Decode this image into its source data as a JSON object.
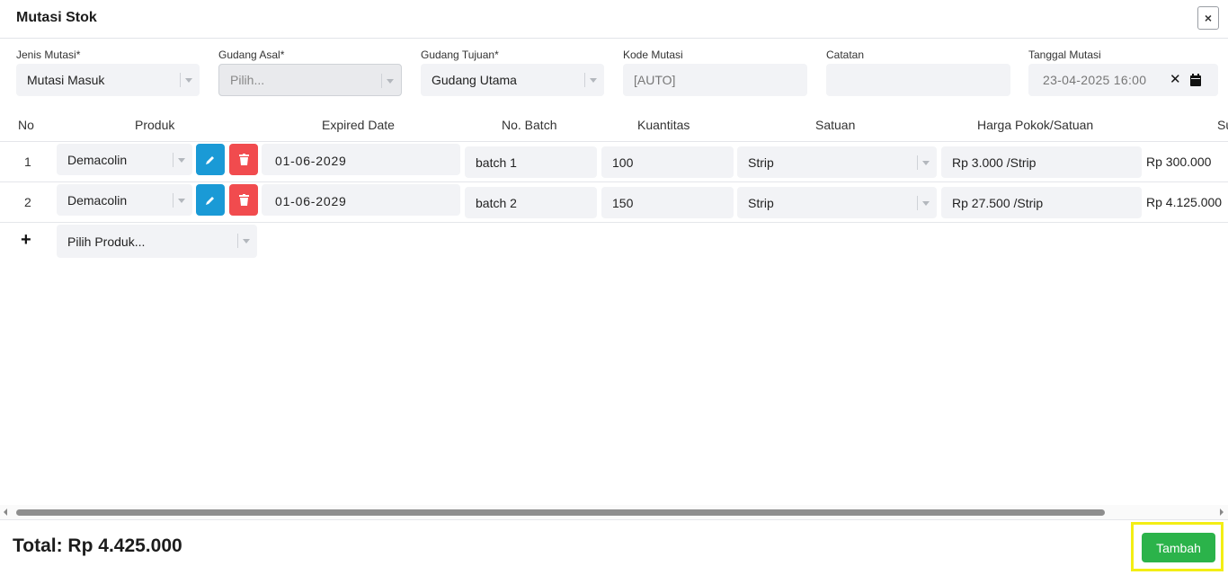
{
  "modal": {
    "title": "Mutasi Stok",
    "close_label": "×"
  },
  "form": {
    "jenis_mutasi": {
      "label": "Jenis Mutasi*",
      "value": "Mutasi Masuk"
    },
    "gudang_asal": {
      "label": "Gudang Asal*",
      "placeholder": "Pilih..."
    },
    "gudang_tujuan": {
      "label": "Gudang Tujuan*",
      "value": "Gudang Utama"
    },
    "kode_mutasi": {
      "label": "Kode Mutasi",
      "value": "[AUTO]"
    },
    "catatan": {
      "label": "Catatan",
      "value": ""
    },
    "tanggal_mutasi": {
      "label": "Tanggal Mutasi",
      "value": "23-04-2025 16:00"
    }
  },
  "table": {
    "headers": [
      "No",
      "Produk",
      "Expired Date",
      "No. Batch",
      "Kuantitas",
      "Satuan",
      "Harga Pokok/Satuan",
      "Su"
    ],
    "rows": [
      {
        "no": "1",
        "produk": "Demacolin",
        "expired": "01-06-2029",
        "batch": "batch 1",
        "qty": "100",
        "satuan": "Strip",
        "harga": "Rp 3.000 /Strip",
        "subtotal": "Rp 300.000"
      },
      {
        "no": "2",
        "produk": "Demacolin",
        "expired": "01-06-2029",
        "batch": "batch 2",
        "qty": "150",
        "satuan": "Strip",
        "harga": "Rp 27.500 /Strip",
        "subtotal": "Rp 4.125.000"
      }
    ],
    "add_row": {
      "icon": "+",
      "placeholder": "Pilih Produk..."
    }
  },
  "footer": {
    "total": "Total: Rp 4.425.000",
    "add_button": "Tambah",
    "highlight_color": "#f3ee14"
  },
  "colors": {
    "edit": "#1a9ad6",
    "delete": "#f14b4e",
    "primary": "#2bb34a"
  }
}
